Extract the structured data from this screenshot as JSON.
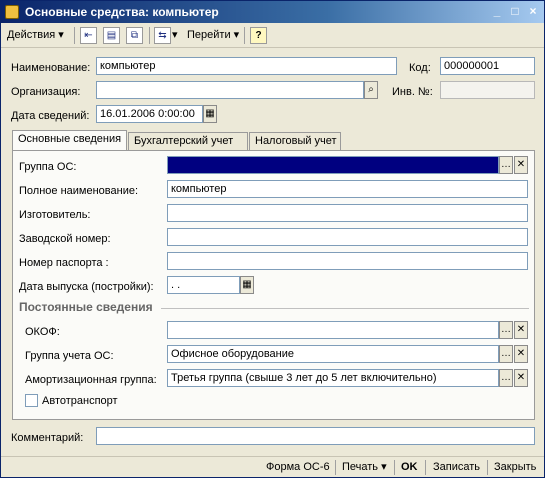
{
  "window": {
    "title": "Основные средства: компьютер"
  },
  "toolbar": {
    "actions_label": "Действия",
    "goto_label": "Перейти",
    "help_label": "?"
  },
  "header": {
    "name_label": "Наименование:",
    "name_value": "компьютер",
    "code_label": "Код:",
    "code_value": "000000001",
    "org_label": "Организация:",
    "org_value": "",
    "inv_label": "Инв. №:",
    "inv_value": "",
    "date_label": "Дата сведений:",
    "date_value": "16.01.2006  0:00:00"
  },
  "tabs": [
    {
      "label": "Основные сведения",
      "active": true
    },
    {
      "label": "Бухгалтерский учет",
      "active": false
    },
    {
      "label": "Налоговый учет",
      "active": false
    }
  ],
  "main": {
    "group_label": "Группа ОС:",
    "group_value": "",
    "full_name_label": "Полное наименование:",
    "full_name_value": "компьютер",
    "maker_label": "Изготовитель:",
    "maker_value": "",
    "serial_label": "Заводской номер:",
    "serial_value": "",
    "passport_label": "Номер паспорта :",
    "passport_value": "",
    "release_label": "Дата выпуска (постройки):",
    "release_value": " .  .",
    "section_title": "Постоянные сведения",
    "okof_label": "ОКОФ:",
    "okof_value": "",
    "acc_group_label": "Группа учета ОС:",
    "acc_group_value": "Офисное оборудование",
    "amort_label": "Амортизационная группа:",
    "amort_value": "Третья группа (свыше 3 лет до 5 лет включительно)",
    "vehicle_label": "Автотранспорт"
  },
  "footer": {
    "comment_label": "Комментарий:",
    "comment_value": ""
  },
  "bottombar": {
    "form_label": "Форма ОС-6",
    "print_label": "Печать",
    "ok_label": "OK",
    "save_label": "Записать",
    "close_label": "Закрыть"
  },
  "colors": {
    "titlebar": "#0a246a",
    "selection": "#000080",
    "window_bg": "#ece9d8"
  }
}
